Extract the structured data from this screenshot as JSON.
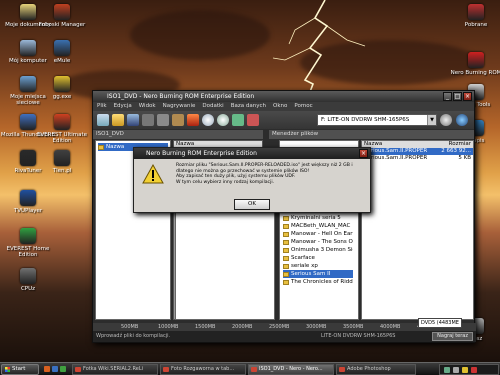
{
  "desktop": {
    "icons_left": [
      {
        "label": "Moje dokumenty",
        "color": "#e8d27a"
      },
      {
        "label": "Foboski Manager",
        "color": "#c04020"
      },
      {
        "label": "Mój komputer",
        "color": "#9ab8d8"
      },
      {
        "label": "eMule",
        "color": "#3a70b0"
      },
      {
        "label": "Moje miejsca sieciowe",
        "color": "#6ca0d0"
      },
      {
        "label": "gg.exe",
        "color": "#e0c030"
      },
      {
        "label": "Mozilla Thunderbird",
        "color": "#4070c0"
      },
      {
        "label": "EVEREST Ultimate Edition",
        "color": "#d04020"
      },
      {
        "label": "RivaTuner",
        "color": "#2a2a2a"
      },
      {
        "label": "Tlen.pl",
        "color": "#404040"
      },
      {
        "label": "TVUPlayer",
        "color": "#2050a0"
      },
      {
        "label": "EVEREST Home Edition",
        "color": "#30a040"
      },
      {
        "label": "CPUz",
        "color": "#707070"
      }
    ],
    "icons_right": [
      {
        "label": "Pobrane",
        "color": "#c03030"
      },
      {
        "label": "Nero Burning ROM",
        "color": "#d02020"
      },
      {
        "label": "MON Tools",
        "color": "#d0d0d0"
      },
      {
        "label": "Prapis",
        "color": "#3080c0"
      },
      {
        "label": "Kosz",
        "color": "#b0b0b0"
      }
    ]
  },
  "window": {
    "title": "ISO1_DVD - Nero Burning ROM Enterprise Edition",
    "menu": [
      "Plik",
      "Edycja",
      "Widok",
      "Nagrywanie",
      "Dodatki",
      "Baza danych",
      "Okno",
      "Pomoc"
    ],
    "drive": "F: LITE-ON DVDRW SHM-165P6S",
    "left_pane_title": "ISO1_DVD",
    "right_pane_title": "Menedżer plików",
    "tree_item": "Nazwa",
    "col_name": "Nazwa",
    "col_size": "Rozmiar",
    "folders": [
      "Cold Fear",
      "Heroes V",
      "Just Cause",
      "Kryminalni seria 5",
      "MACBeth_WLAN_MAC",
      "Manowar - Hell On Earth",
      "Manowar - The Sons Of",
      "Onimusha 3 Demon Sie",
      "Scarface",
      "seriale xp",
      "Serious Sam II",
      "The Chronicles of Riddick"
    ],
    "selected_folder": "Serious Sam II",
    "files": [
      {
        "name": "Serious.Sam.II.PROPER",
        "size": "2 663 92..."
      },
      {
        "name": "Serious.Sam.II.PROPER",
        "size": "5 KB"
      }
    ],
    "ruler": [
      "500MB",
      "1000MB",
      "1500MB",
      "2000MB",
      "2500MB",
      "3000MB",
      "3500MB",
      "4000MB",
      "4500MB"
    ],
    "status_text": "Wprowadź pliki do kompilacji.",
    "status_drive": "LITE-ON DVDRW SHM-165P6S",
    "status_button": "Nagraj teraz",
    "disc_type": "DVD5 (4483ME"
  },
  "dialog": {
    "title": "Nero Burning ROM Enterprise Edition",
    "message": "Rozmiar pliku \"Serious.Sam.II.PROPER-RELOADED.iso\" jest większy niż 2 GB i dlatego nie można go przechować w systemie plików ISO!\nAby zapisać ten duży plik, użyj systemu plików UDF.\nW tym celu wybierz inny rodzaj kompilacji.",
    "ok_label": "OK"
  },
  "taskbar": {
    "start_label": "Start",
    "tasks": [
      "Fotka Wiki.SERIAL2.ReLi",
      "Foto Rozgaworna w tab...",
      "ISO1_DVD - Nero - Nero...",
      "Adobe Photoshop"
    ],
    "active_task": 2
  }
}
